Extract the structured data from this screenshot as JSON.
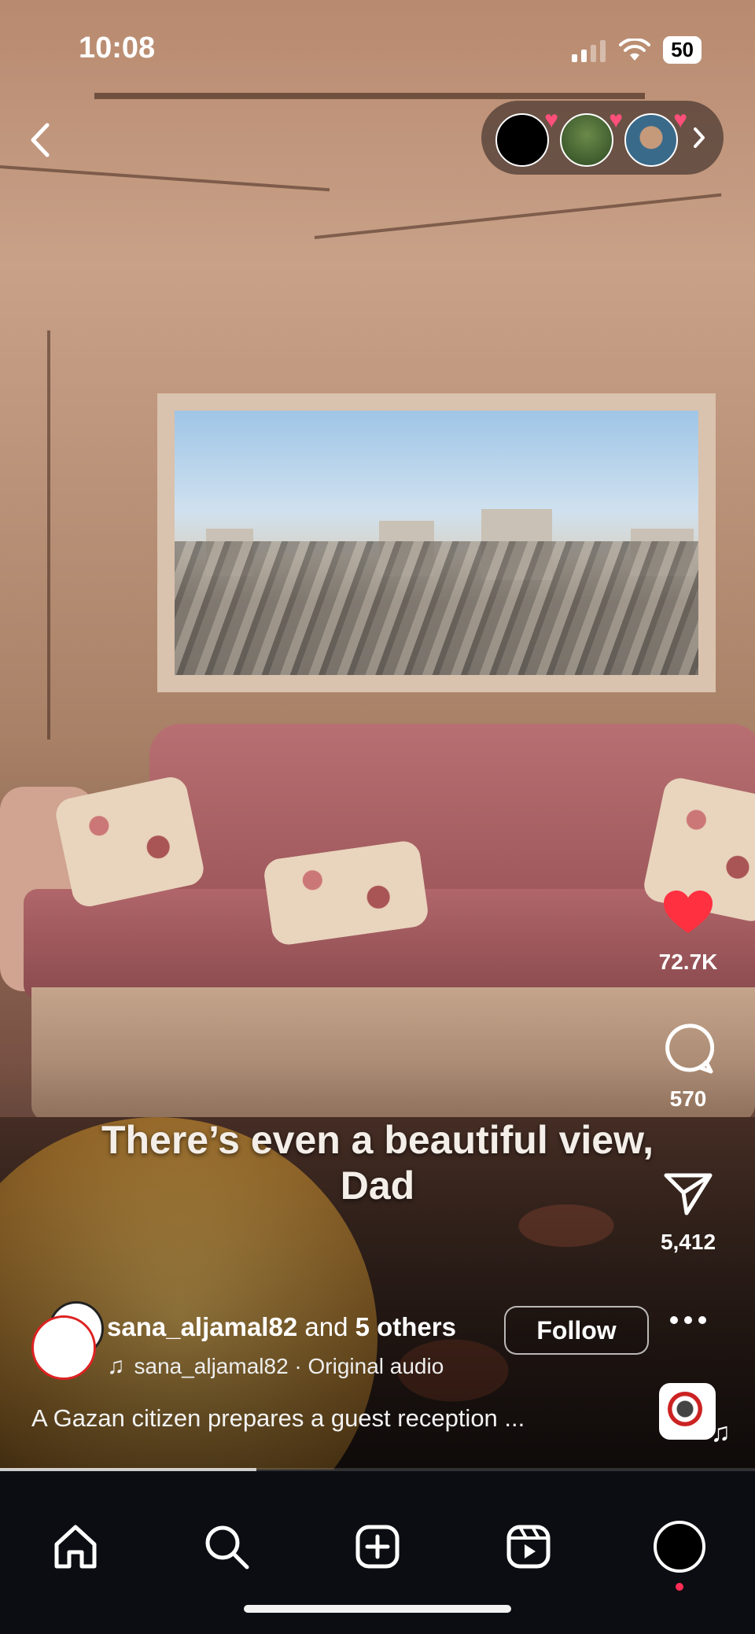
{
  "status_bar": {
    "time": "10:08",
    "battery": "50"
  },
  "top": {
    "back_icon": "chevron-left-icon",
    "more_icon": "chevron-right-icon"
  },
  "video": {
    "caption_line1": "There’s even a beautiful view,",
    "caption_line2": "Dad"
  },
  "actions": {
    "likes": "72.7K",
    "comments": "570",
    "shares": "5,412",
    "like_color": "#ff3040"
  },
  "author": {
    "username": "sana_aljamal82",
    "and_text": "and",
    "others": "5 others",
    "follow_label": "Follow",
    "audio_text": "sana_aljamal82 · Original audio"
  },
  "description": "A Gazan citizen prepares a guest reception ...",
  "progress_fraction": 0.34,
  "tabbar": {
    "items": [
      "home-icon",
      "search-icon",
      "create-icon",
      "reels-icon",
      "profile-icon"
    ],
    "notification_dot_color": "#ff2d55"
  }
}
